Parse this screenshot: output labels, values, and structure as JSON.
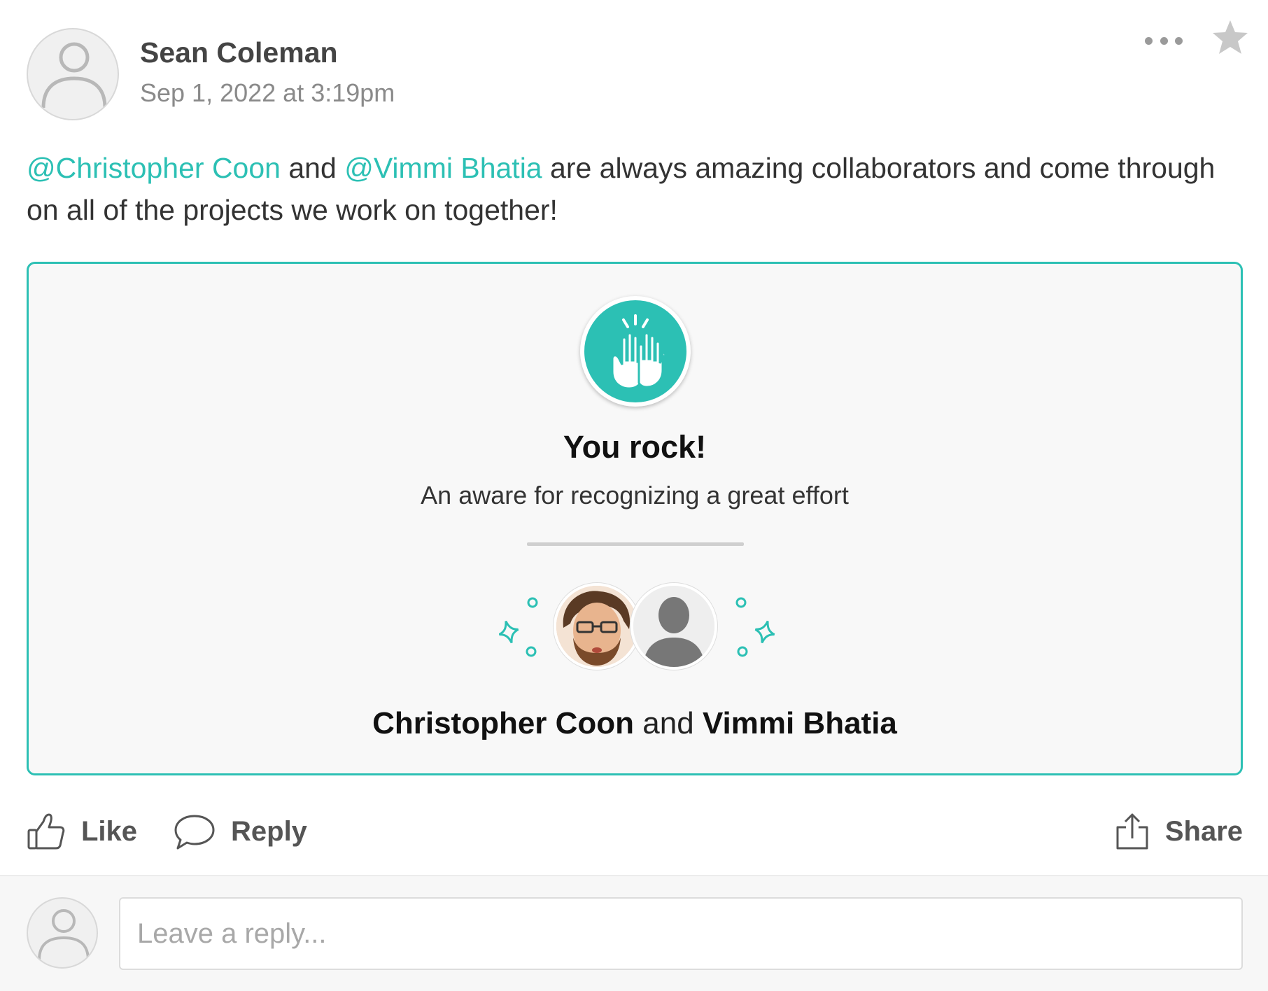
{
  "post": {
    "author_name": "Sean Coleman",
    "timestamp": "Sep 1, 2022 at 3:19pm",
    "body": {
      "mention_1": "@Christopher Coon",
      "connector": "and",
      "mention_2": "@Vimmi Bhatia",
      "text": "are always amazing collaborators and come through on all of the projects we work on together!"
    }
  },
  "award": {
    "icon": "high-five-icon",
    "title": "You rock!",
    "description": "An aware for recognizing a great effort",
    "recipient_1": "Christopher Coon",
    "recipient_connector": "and",
    "recipient_2": "Vimmi Bhatia"
  },
  "actions": {
    "like_label": "Like",
    "reply_label": "Reply",
    "share_label": "Share"
  },
  "reply_box": {
    "placeholder": "Leave a reply..."
  },
  "colors": {
    "accent": "#2cc0b4",
    "card_background": "#f8f8f8",
    "text": "#333333",
    "muted": "#8a8a8a"
  }
}
